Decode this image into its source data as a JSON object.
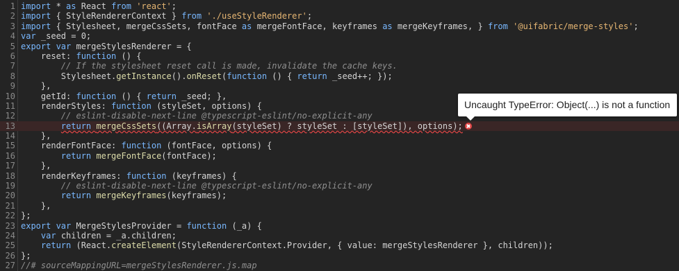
{
  "error_tooltip": {
    "message": "Uncaught TypeError: Object(...) is not a function"
  },
  "lines": [
    {
      "n": "1",
      "parts": [
        [
          "kw",
          "import "
        ],
        [
          "pl",
          "* "
        ],
        [
          "kw",
          "as "
        ],
        [
          "pl",
          "React "
        ],
        [
          "kw",
          "from "
        ],
        [
          "str",
          "'react'"
        ],
        [
          "pl",
          ";"
        ]
      ]
    },
    {
      "n": "2",
      "parts": [
        [
          "kw",
          "import "
        ],
        [
          "pl",
          "{ StyleRendererContext } "
        ],
        [
          "kw",
          "from "
        ],
        [
          "str",
          "'./useStyleRenderer'"
        ],
        [
          "pl",
          ";"
        ]
      ]
    },
    {
      "n": "3",
      "parts": [
        [
          "kw",
          "import "
        ],
        [
          "pl",
          "{ Stylesheet, mergeCssSets, fontFace "
        ],
        [
          "kw",
          "as "
        ],
        [
          "pl",
          "mergeFontFace, keyframes "
        ],
        [
          "kw",
          "as "
        ],
        [
          "pl",
          "mergeKeyframes, } "
        ],
        [
          "kw",
          "from "
        ],
        [
          "str",
          "'@uifabric/merge-styles'"
        ],
        [
          "pl",
          ";"
        ]
      ]
    },
    {
      "n": "4",
      "parts": [
        [
          "kw",
          "var "
        ],
        [
          "pl",
          "_seed = 0;"
        ]
      ]
    },
    {
      "n": "5",
      "parts": [
        [
          "kw",
          "export var "
        ],
        [
          "pl",
          "mergeStylesRenderer = {"
        ]
      ]
    },
    {
      "n": "6",
      "parts": [
        [
          "pl",
          "    reset: "
        ],
        [
          "kw",
          "function "
        ],
        [
          "pl",
          "() {"
        ]
      ]
    },
    {
      "n": "7",
      "parts": [
        [
          "cm",
          "        // If the stylesheet reset call is made, invalidate the cache keys."
        ]
      ]
    },
    {
      "n": "8",
      "parts": [
        [
          "pl",
          "        Stylesheet."
        ],
        [
          "fn",
          "getInstance"
        ],
        [
          "pl",
          "()."
        ],
        [
          "fn",
          "onReset"
        ],
        [
          "pl",
          "("
        ],
        [
          "kw",
          "function "
        ],
        [
          "pl",
          "() { "
        ],
        [
          "kw",
          "return "
        ],
        [
          "pl",
          "_seed++; });"
        ]
      ]
    },
    {
      "n": "9",
      "parts": [
        [
          "pl",
          "    },"
        ]
      ]
    },
    {
      "n": "10",
      "parts": [
        [
          "pl",
          "    getId: "
        ],
        [
          "kw",
          "function "
        ],
        [
          "pl",
          "() { "
        ],
        [
          "kw",
          "return "
        ],
        [
          "pl",
          "_seed; },"
        ]
      ]
    },
    {
      "n": "11",
      "parts": [
        [
          "pl",
          "    renderStyles: "
        ],
        [
          "kw",
          "function "
        ],
        [
          "pl",
          "(styleSet, options) {"
        ]
      ]
    },
    {
      "n": "12",
      "parts": [
        [
          "cm",
          "        // eslint-disable-next-line @typescript-eslint/no-explicit-any"
        ]
      ]
    },
    {
      "n": "13",
      "error": true,
      "parts": [
        [
          "pl",
          "        "
        ],
        [
          "kw",
          "return "
        ],
        [
          "fn",
          "mergeCssSets"
        ],
        [
          "pl",
          "((Array."
        ],
        [
          "fn",
          "isArray"
        ],
        [
          "pl",
          "(styleSet) ? styleSet : [styleSet]), options);"
        ]
      ]
    },
    {
      "n": "14",
      "parts": [
        [
          "pl",
          "    },"
        ]
      ]
    },
    {
      "n": "15",
      "parts": [
        [
          "pl",
          "    renderFontFace: "
        ],
        [
          "kw",
          "function "
        ],
        [
          "pl",
          "(fontFace, options) {"
        ]
      ]
    },
    {
      "n": "16",
      "parts": [
        [
          "pl",
          "        "
        ],
        [
          "kw",
          "return "
        ],
        [
          "fn",
          "mergeFontFace"
        ],
        [
          "pl",
          "(fontFace);"
        ]
      ]
    },
    {
      "n": "17",
      "parts": [
        [
          "pl",
          "    },"
        ]
      ]
    },
    {
      "n": "18",
      "parts": [
        [
          "pl",
          "    renderKeyframes: "
        ],
        [
          "kw",
          "function "
        ],
        [
          "pl",
          "(keyframes) {"
        ]
      ]
    },
    {
      "n": "19",
      "parts": [
        [
          "cm",
          "        // eslint-disable-next-line @typescript-eslint/no-explicit-any"
        ]
      ]
    },
    {
      "n": "20",
      "parts": [
        [
          "pl",
          "        "
        ],
        [
          "kw",
          "return "
        ],
        [
          "fn",
          "mergeKeyframes"
        ],
        [
          "pl",
          "(keyframes);"
        ]
      ]
    },
    {
      "n": "21",
      "parts": [
        [
          "pl",
          "    },"
        ]
      ]
    },
    {
      "n": "22",
      "parts": [
        [
          "pl",
          "};"
        ]
      ]
    },
    {
      "n": "23",
      "parts": [
        [
          "kw",
          "export var "
        ],
        [
          "pl",
          "MergeStylesProvider = "
        ],
        [
          "kw",
          "function "
        ],
        [
          "pl",
          "(_a) {"
        ]
      ]
    },
    {
      "n": "24",
      "parts": [
        [
          "pl",
          "    "
        ],
        [
          "kw",
          "var "
        ],
        [
          "pl",
          "children = _a.children;"
        ]
      ]
    },
    {
      "n": "25",
      "parts": [
        [
          "pl",
          "    "
        ],
        [
          "kw",
          "return "
        ],
        [
          "pl",
          "(React."
        ],
        [
          "fn",
          "createElement"
        ],
        [
          "pl",
          "(StyleRendererContext.Provider, { value: mergeStylesRenderer }, children));"
        ]
      ]
    },
    {
      "n": "26",
      "parts": [
        [
          "pl",
          "};"
        ]
      ]
    },
    {
      "n": "27",
      "parts": [
        [
          "cm",
          "//# sourceMappingURL=mergeStylesRenderer.js.map"
        ]
      ]
    }
  ],
  "colors": {
    "background": "#242424",
    "keyword": "#79b8ff",
    "function": "#dcdcaa",
    "string": "#e6b673",
    "comment": "#8f8f8f",
    "error": "#e04545"
  },
  "icons": {
    "error_marker": "error-circle-icon"
  }
}
